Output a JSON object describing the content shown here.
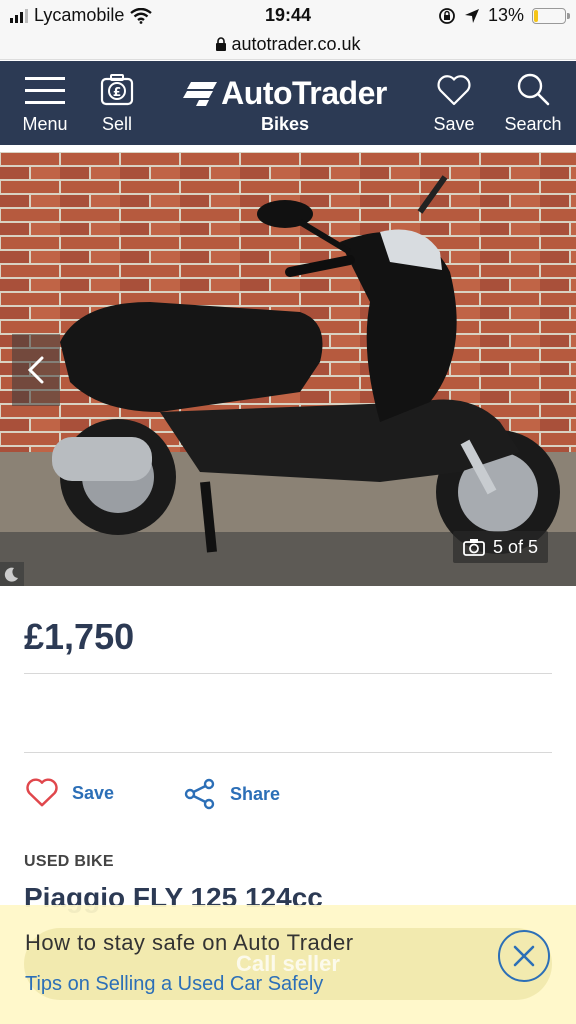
{
  "status_bar": {
    "carrier": "Lycamobile",
    "time": "19:44",
    "battery_percent": "13%",
    "battery_level": 0.13
  },
  "url_bar": {
    "url": "autotrader.co.uk"
  },
  "header": {
    "menu_label": "Menu",
    "sell_label": "Sell",
    "logo_text": "AutoTrader",
    "logo_sub": "Bikes",
    "save_label": "Save",
    "search_label": "Search"
  },
  "gallery": {
    "counter": "5 of 5"
  },
  "listing": {
    "price": "£1,750",
    "save_label": "Save",
    "share_label": "Share",
    "condition": "USED BIKE",
    "title": "Piaggio FLY 125 124cc"
  },
  "cta": {
    "label": "Call seller"
  },
  "banner": {
    "title": "How to stay safe on Auto Trader",
    "link": "Tips on Selling a Used Car Safely"
  },
  "colors": {
    "header_bg": "#2c3a54",
    "accent_blue": "#2c6fb7",
    "heart_red": "#e0474c",
    "banner_bg": "#fff8c8"
  }
}
